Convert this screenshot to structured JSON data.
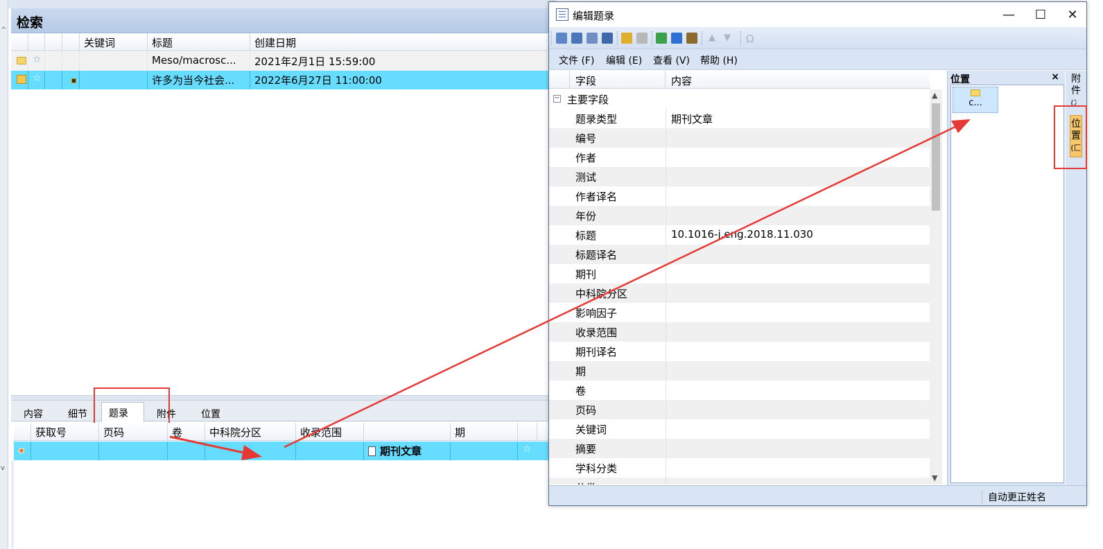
{
  "search_panel": {
    "title": "检索",
    "columns": [
      "关键词",
      "标题",
      "创建日期"
    ],
    "rows": [
      {
        "keyword": "",
        "title": "Meso/macrosc...",
        "created": "2021年2月1日 15:59:00"
      },
      {
        "keyword": "",
        "title": "许多为当今社会...",
        "created": "2022年6月27日 11:00:00"
      }
    ]
  },
  "bottom_tabs": [
    "内容",
    "细节",
    "题录",
    "附件",
    "位置"
  ],
  "active_bottom_tab": "题录",
  "record_table": {
    "columns": [
      "获取号",
      "页码",
      "卷",
      "中科院分区",
      "收录范围",
      "",
      "期"
    ],
    "row": {
      "type_label": "期刊文章"
    }
  },
  "dialog": {
    "title": "编辑题录",
    "window_buttons": {
      "minimize": "—",
      "maximize": "☐",
      "close": "✕"
    },
    "menu": [
      "文件 (F)",
      "编辑 (E)",
      "查看 (V)",
      "帮助 (H)"
    ],
    "field_columns": [
      "字段",
      "内容"
    ],
    "group_label": "主要字段",
    "fields": [
      {
        "name": "题录类型",
        "value": "期刊文章"
      },
      {
        "name": "编号",
        "value": ""
      },
      {
        "name": "作者",
        "value": ""
      },
      {
        "name": "测试",
        "value": ""
      },
      {
        "name": "作者译名",
        "value": ""
      },
      {
        "name": "年份",
        "value": ""
      },
      {
        "name": "标题",
        "value": "10.1016-j.eng.2018.11.030"
      },
      {
        "name": "标题译名",
        "value": ""
      },
      {
        "name": "期刊",
        "value": ""
      },
      {
        "name": "中科院分区",
        "value": ""
      },
      {
        "name": "影响因子",
        "value": ""
      },
      {
        "name": "收录范围",
        "value": ""
      },
      {
        "name": "期刊译名",
        "value": ""
      },
      {
        "name": "期",
        "value": ""
      },
      {
        "name": "卷",
        "value": ""
      },
      {
        "name": "页码",
        "value": ""
      },
      {
        "name": "关键词",
        "value": ""
      },
      {
        "name": "摘要",
        "value": ""
      },
      {
        "name": "学科分类",
        "value": ""
      },
      {
        "name": "分类",
        "value": ""
      }
    ],
    "position_panel": {
      "title": "位置",
      "close": "×",
      "item_label": "c..."
    },
    "side_tabs": [
      {
        "label": "附件",
        "glyph": "(冫"
      },
      {
        "label": "位置",
        "glyph": "(匚"
      }
    ],
    "status_text": "自动更正姓名"
  },
  "colors": {
    "selection": "#66ddff",
    "highlight_red": "#e53935",
    "panel_blue": "#d9e5f4",
    "header_blue": "#b6cbe6"
  }
}
